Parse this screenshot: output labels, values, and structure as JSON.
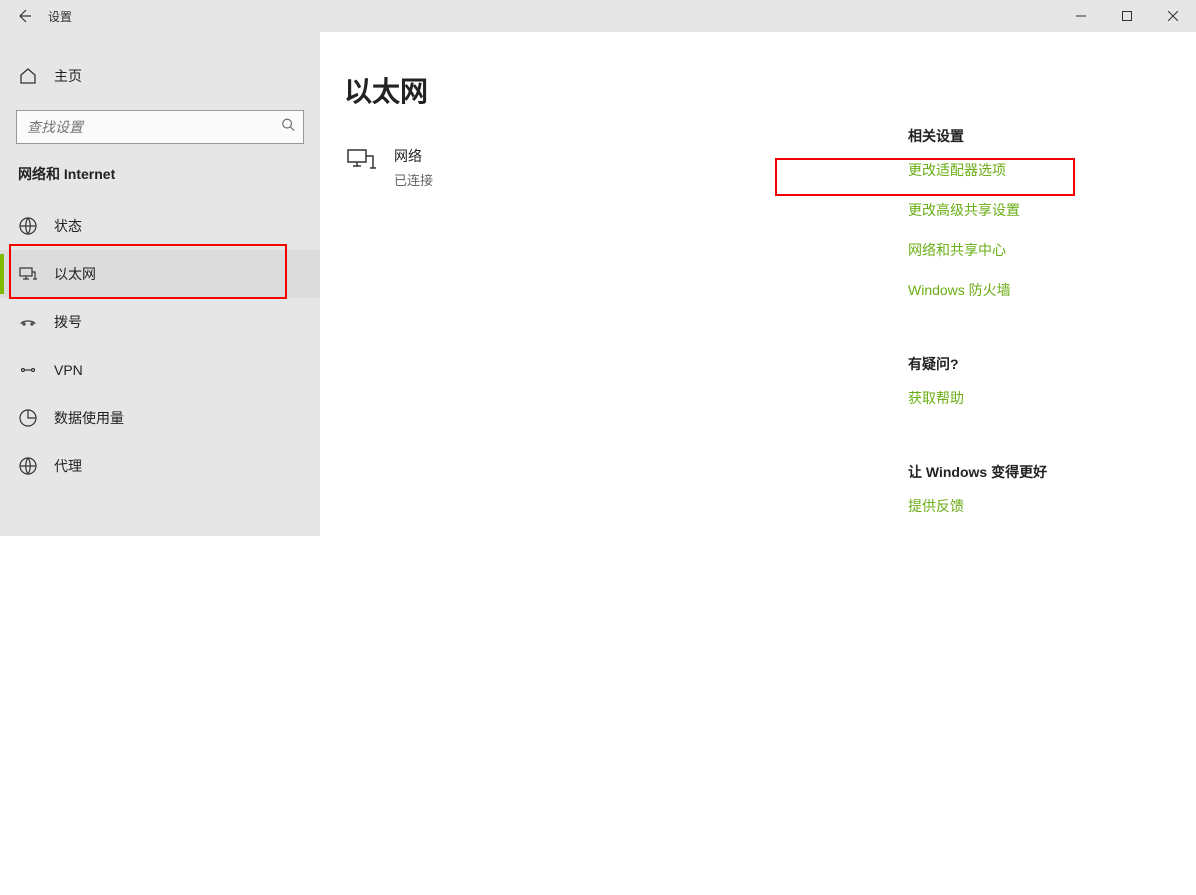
{
  "titlebar": {
    "title": "设置"
  },
  "sidebar": {
    "home": "主页",
    "search_placeholder": "查找设置",
    "group_title": "网络和 Internet",
    "items": [
      {
        "label": "状态"
      },
      {
        "label": "以太网"
      },
      {
        "label": "拨号"
      },
      {
        "label": "VPN"
      },
      {
        "label": "数据使用量"
      },
      {
        "label": "代理"
      }
    ],
    "active_index": 1
  },
  "main": {
    "title": "以太网",
    "network": {
      "name": "网络",
      "status": "已连接"
    }
  },
  "right": {
    "related_title": "相关设置",
    "links": [
      "更改适配器选项",
      "更改高级共享设置",
      "网络和共享中心",
      "Windows 防火墙"
    ],
    "qa_title": "有疑问?",
    "qa_link": "获取帮助",
    "fb_title": "让 Windows 变得更好",
    "fb_link": "提供反馈"
  }
}
